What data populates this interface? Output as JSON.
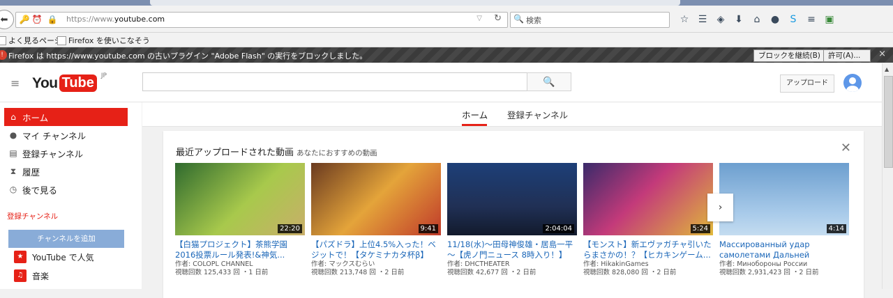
{
  "browser": {
    "url_prefix": "https://www.",
    "url_domain": "youtube.com",
    "search_placeholder": "検索",
    "bookmarks": [
      "よく見るページ",
      "Firefox を使いこなそう"
    ],
    "notice": {
      "message": "Firefox は https://www.youtube.com の古いプラグイン \"Adobe Flash\" の実行をブロックしました。",
      "continue_block": "ブロックを継続(B)",
      "allow": "許可(A)..."
    }
  },
  "youtube": {
    "logo_you": "You",
    "logo_tube": "Tube",
    "region": "JP",
    "upload_label": "アップロード",
    "sidebar": {
      "items": [
        "ホーム",
        "マイ チャンネル",
        "登録チャンネル",
        "履歴",
        "後で見る"
      ],
      "subscriptions_heading": "登録チャンネル",
      "add_channel": "チャンネルを追加",
      "channels": [
        "YouTube で人気",
        "音楽"
      ]
    },
    "tabs": [
      "ホーム",
      "登録チャンネル"
    ],
    "section": {
      "title": "最近アップロードされた動画",
      "subtitle": "あなたにおすすめの動画"
    },
    "videos": [
      {
        "duration": "22:20",
        "title": "【白猫プロジェクト】茶熊学園2016投票ルール発表!&神気...",
        "author": "作者: COLOPL CHANNEL",
        "stats": "視聴回数 125,433 回 ・1 日前"
      },
      {
        "duration": "9:41",
        "title": "【パズドラ】上位4.5%入った！ベジットで！【タケミナカタ杯β】",
        "author": "作者: マックスむらい",
        "stats": "視聴回数 213,748 回 ・2 日前"
      },
      {
        "duration": "2:04:04",
        "title": "11/18(水)～田母神俊雄・居島一平～【虎ノ門ニュース 8時入り！】",
        "author": "作者: DHCTHEATER",
        "stats": "視聴回数 42,677 回 ・2 日前"
      },
      {
        "duration": "5:24",
        "title": "【モンスト】新エヴァガチャ引いたらまさかの！？【ヒカキンゲーム...",
        "author": "作者: HikakinGames",
        "stats": "視聴回数 828,080 回 ・2 日前"
      },
      {
        "duration": "4:14",
        "title": "Массированный удар самолетами Дальней",
        "author": "作者: Минобороны России",
        "stats": "視聴回数 2,931,423 回 ・2 日前"
      }
    ]
  }
}
